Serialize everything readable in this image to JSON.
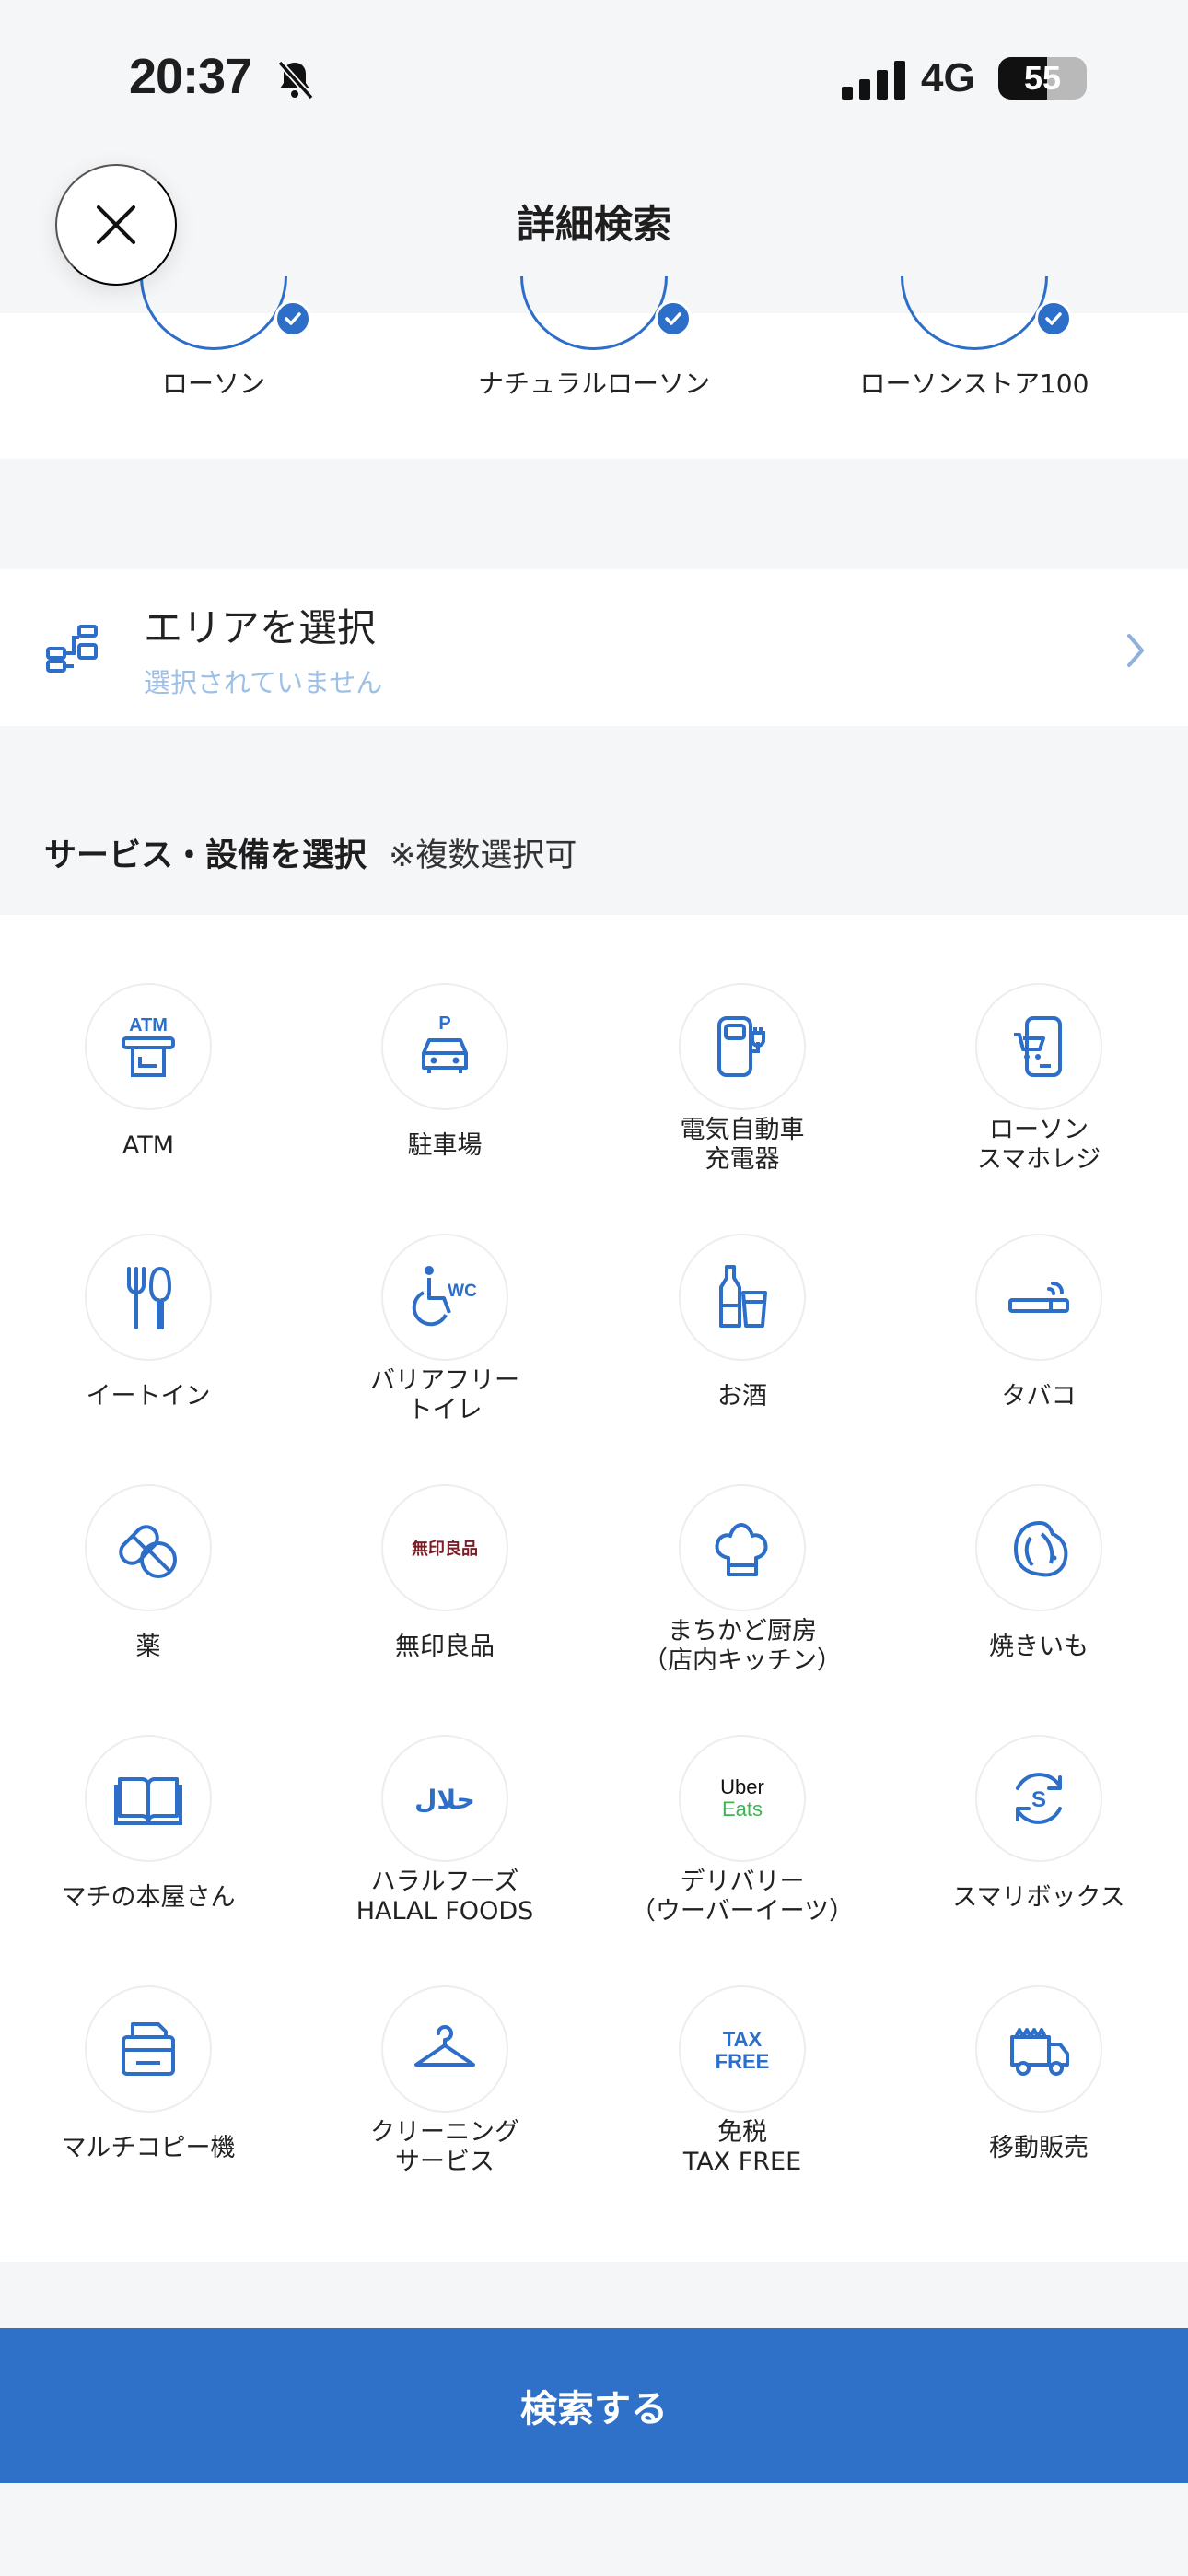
{
  "status_bar": {
    "time": "20:37",
    "network": "4G",
    "battery": "55",
    "battery_level": 0.55
  },
  "header": {
    "title": "詳細検索"
  },
  "brands": [
    {
      "name": "ローソン",
      "checked": true
    },
    {
      "name": "ナチュラルローソン",
      "checked": true
    },
    {
      "name": "ローソンストア100",
      "checked": true
    }
  ],
  "area": {
    "title": "エリアを選択",
    "subtitle": "選択されていません"
  },
  "services_header": {
    "title": "サービス・設備を選択",
    "note": "※複数選択可"
  },
  "services": [
    {
      "label": "ATM",
      "icon": "atm-icon"
    },
    {
      "label": "駐車場",
      "icon": "parking-icon"
    },
    {
      "label": "電気自動車\n充電器",
      "icon": "ev-charger-icon"
    },
    {
      "label": "ローソン\nスマホレジ",
      "icon": "smartphone-register-icon"
    },
    {
      "label": "イートイン",
      "icon": "eat-in-icon"
    },
    {
      "label": "バリアフリー\nトイレ",
      "icon": "accessible-toilet-icon"
    },
    {
      "label": "お酒",
      "icon": "alcohol-icon"
    },
    {
      "label": "タバコ",
      "icon": "tobacco-icon"
    },
    {
      "label": "薬",
      "icon": "medicine-icon"
    },
    {
      "label": "無印良品",
      "icon": "muji-logo-icon",
      "logo_text": "無印良品"
    },
    {
      "label": "まちかど厨房\n（店内キッチン）",
      "icon": "chef-hat-icon"
    },
    {
      "label": "焼きいも",
      "icon": "sweet-potato-icon"
    },
    {
      "label": "マチの本屋さん",
      "icon": "book-icon"
    },
    {
      "label": "ハラルフーズ\nHALAL FOODS",
      "icon": "halal-icon",
      "logo_text": "حلال"
    },
    {
      "label": "デリバリー\n（ウーバーイーツ）",
      "icon": "uber-eats-logo-icon",
      "logo_text": [
        "Uber",
        "Eats"
      ]
    },
    {
      "label": "スマリボックス",
      "icon": "smari-box-icon"
    },
    {
      "label": "マルチコピー機",
      "icon": "multi-copy-icon"
    },
    {
      "label": "クリーニング\nサービス",
      "icon": "hanger-icon"
    },
    {
      "label": "免税\nTAX FREE",
      "icon": "tax-free-icon",
      "logo_text": [
        "TAX",
        "FREE"
      ]
    },
    {
      "label": "移動販売",
      "icon": "mobile-sales-truck-icon"
    }
  ],
  "footer": {
    "search_label": "検索する"
  },
  "colors": {
    "accent": "#2F70C9",
    "muji": "#7A1E27",
    "uber_green": "#3FB454",
    "placeholder": "#9DC0E6"
  }
}
